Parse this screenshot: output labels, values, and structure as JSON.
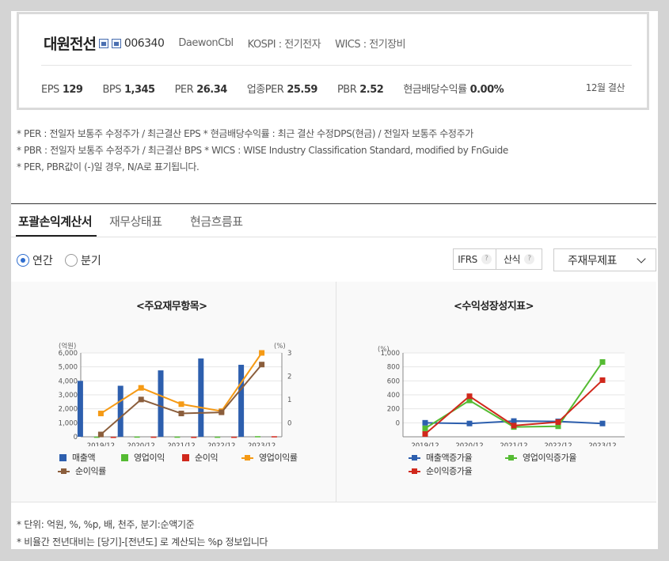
{
  "header": {
    "company_name": "대원전선",
    "code": "006340",
    "english_name": "DaewonCbl",
    "market": "KOSPI : 전기전자",
    "wics": "WICS : 전기장비",
    "settlement": "12월 결산",
    "metrics": [
      {
        "label": "EPS",
        "value": "129"
      },
      {
        "label": "BPS",
        "value": "1,345"
      },
      {
        "label": "PER",
        "value": "26.34"
      },
      {
        "label": "업종PER",
        "value": "25.59"
      },
      {
        "label": "PBR",
        "value": "2.52"
      },
      {
        "label": "현금배당수익률",
        "value": "0.00%"
      }
    ]
  },
  "notes": [
    "* PER : 전일자 보통주 수정주가 / 최근결산 EPS * 현금배당수익률 : 최근 결산 수정DPS(현금) / 전일자 보통주 수정주가",
    "* PBR : 전일자 보통주 수정주가 / 최근결산 BPS * WICS : WISE Industry Classification Standard, modified by FnGuide",
    "* PER, PBR값이 (-)일 경우, N/A로 표기됩니다."
  ],
  "tabs": [
    {
      "label": "포괄손익계산서",
      "active": true
    },
    {
      "label": "재무상태표",
      "active": false
    },
    {
      "label": "현금흐름표",
      "active": false
    }
  ],
  "period": {
    "annual": "연간",
    "quarter": "분기",
    "selected": "연간"
  },
  "ifrs_button": "IFRS",
  "calc_button": "산식",
  "help_glyph": "?",
  "select": {
    "value": "주재무제표"
  },
  "chart_data": [
    {
      "type": "bar",
      "title": "<주요재무항목>",
      "categories": [
        "2019/12",
        "2020/12",
        "2021/12",
        "2022/12",
        "2023/12"
      ],
      "y_unit_left": "(억원)",
      "y_unit_right": "(%)",
      "ylim_left": [
        0,
        6000
      ],
      "yticks_left": [
        "0",
        "1,000",
        "2,000",
        "3,000",
        "4,000",
        "5,000",
        "6,000"
      ],
      "ylim_right": [
        -0.6,
        3
      ],
      "yticks_right": [
        "0",
        "1",
        "2",
        "3"
      ],
      "series": [
        {
          "name": "매출액",
          "kind": "bar",
          "axis": "left",
          "color": "#2d5fae",
          "values": [
            4000,
            3650,
            4750,
            5600,
            5150
          ]
        },
        {
          "name": "영업이익",
          "kind": "bar",
          "axis": "left",
          "color": "#55bb33",
          "values": [
            10,
            20,
            15,
            10,
            45
          ]
        },
        {
          "name": "순이익",
          "kind": "bar",
          "axis": "left",
          "color": "#d0281c",
          "values": [
            -20,
            10,
            -10,
            5,
            40
          ]
        },
        {
          "name": "영업이익률",
          "kind": "line",
          "axis": "right",
          "color": "#f59a15",
          "values": [
            0.4,
            1.5,
            0.8,
            0.5,
            3.0
          ]
        },
        {
          "name": "순이익률",
          "kind": "line",
          "axis": "right",
          "color": "#8b5e3c",
          "values": [
            -0.5,
            1.0,
            0.4,
            0.45,
            2.5
          ]
        }
      ]
    },
    {
      "type": "line",
      "title": "<수익성장성지표>",
      "categories": [
        "2019/12",
        "2020/12",
        "2021/12",
        "2022/12",
        "2023/12"
      ],
      "y_unit": "(%)",
      "ylim": [
        -200,
        1000
      ],
      "yticks": [
        "0",
        "200",
        "400",
        "600",
        "800",
        "1,000"
      ],
      "series": [
        {
          "name": "매출액증가율",
          "color": "#2d5fae",
          "values": [
            0,
            -10,
            25,
            20,
            -10
          ]
        },
        {
          "name": "영업이익증가율",
          "color": "#55bb33",
          "values": [
            -80,
            320,
            -60,
            -50,
            870
          ]
        },
        {
          "name": "순이익증가율",
          "color": "#d0281c",
          "values": [
            -160,
            380,
            -40,
            10,
            610
          ]
        }
      ]
    }
  ],
  "footnotes": [
    "* 단위: 억원, %, %p, 배, 천주, 분기:순액기준",
    "* 비율간 전년대비는 [당기]-[전년도] 로 계산되는 %p 정보입니다"
  ]
}
